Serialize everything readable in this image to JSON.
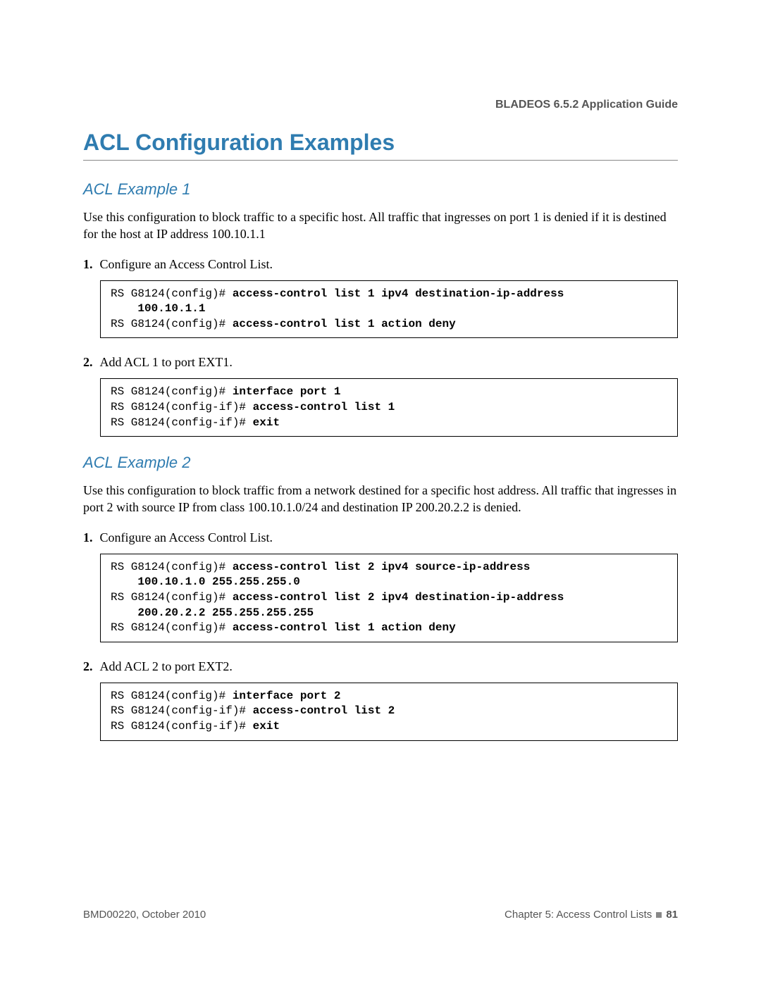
{
  "header": {
    "running": "BLADEOS 6.5.2 Application Guide"
  },
  "title": "ACL Configuration Examples",
  "example1": {
    "heading": "ACL Example 1",
    "intro": "Use this configuration to block traffic to a specific host. All traffic that ingresses on port 1 is denied if it is destined for the host at IP address 100.10.1.1",
    "step1_num": "1.",
    "step1_text": "Configure an Access Control List.",
    "code1_p1": "RS G8124(config)# ",
    "code1_b1": "access-control list 1 ipv4 destination-ip-address",
    "code1_b1b": "    100.10.1.1",
    "code1_p2": "RS G8124(config)# ",
    "code1_b2": "access-control list 1 action deny",
    "step2_num": "2.",
    "step2_text": "Add ACL 1 to port EXT1.",
    "code2_p1": "RS G8124(config)# ",
    "code2_b1": "interface port 1",
    "code2_p2": "RS G8124(config-if)# ",
    "code2_b2": "access-control list 1",
    "code2_p3": "RS G8124(config-if)# ",
    "code2_b3": "exit"
  },
  "example2": {
    "heading": "ACL Example 2",
    "intro": "Use this configuration to block traffic from a network destined for a specific host address. All traffic that ingresses in port 2 with source IP from class 100.10.1.0/24 and destination IP 200.20.2.2 is denied.",
    "step1_num": "1.",
    "step1_text": "Configure an Access Control List.",
    "code1_p1": "RS G8124(config)# ",
    "code1_b1": "access-control list 2 ipv4 source-ip-address",
    "code1_b1b": "    100.10.1.0 255.255.255.0",
    "code1_p2": "RS G8124(config)# ",
    "code1_b2": "access-control list 2 ipv4 destination-ip-address",
    "code1_b2b": "    200.20.2.2 255.255.255.255",
    "code1_p3": "RS G8124(config)# ",
    "code1_b3": "access-control list 1 action deny",
    "step2_num": "2.",
    "step2_text": "Add ACL 2 to port EXT2.",
    "code2_p1": "RS G8124(config)# ",
    "code2_b1": "interface port 2",
    "code2_p2": "RS G8124(config-if)# ",
    "code2_b2": "access-control list 2",
    "code2_p3": "RS G8124(config-if)# ",
    "code2_b3": "exit"
  },
  "footer": {
    "left": "BMD00220, October 2010",
    "right_prefix": "Chapter 5: Access Control Lists",
    "page": "81"
  }
}
